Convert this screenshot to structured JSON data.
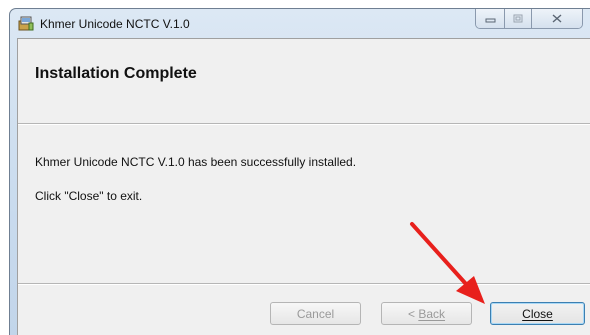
{
  "window": {
    "title": "Khmer Unicode NCTC V.1.0",
    "caption_icons": [
      "minimize-icon",
      "maximize-icon",
      "close-icon"
    ]
  },
  "header": {
    "title": "Installation Complete"
  },
  "body": {
    "message_1": "Khmer Unicode NCTC V.1.0 has been successfully installed.",
    "message_2": "Click \"Close\" to exit."
  },
  "buttons": {
    "cancel": "Cancel",
    "back": "Back",
    "back_prefix": "< ",
    "close": "Close",
    "cancel_enabled": false,
    "back_enabled": false,
    "close_enabled": true
  },
  "annotation": {
    "color": "#e8201c",
    "icon": "red-arrow-icon"
  }
}
